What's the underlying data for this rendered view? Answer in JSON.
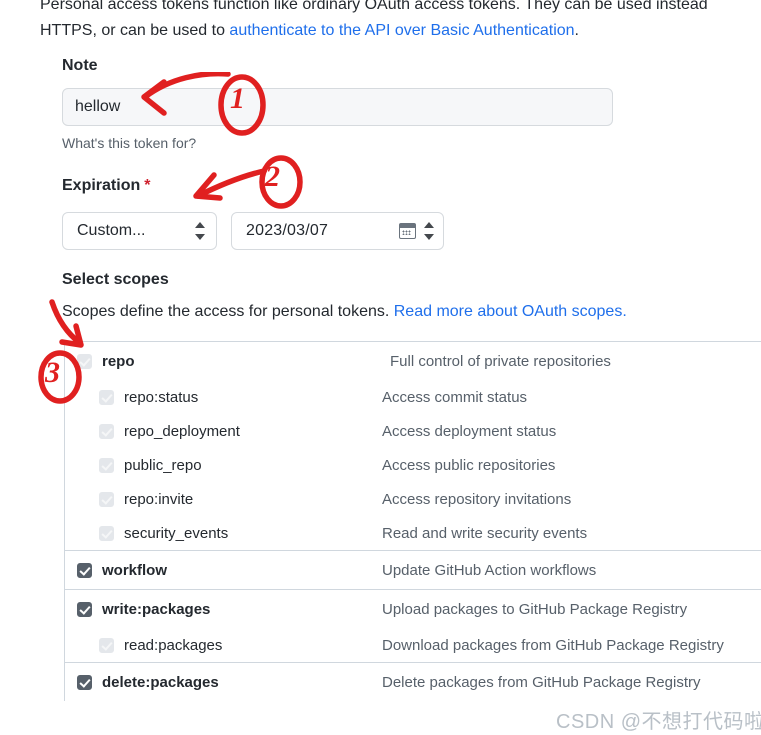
{
  "intro": {
    "line1": "Personal access tokens function like ordinary OAuth access tokens. They can be used instead",
    "line2_pre": "HTTPS, or can be used to ",
    "line2_link": "authenticate to the API over Basic Authentication",
    "line2_post": "."
  },
  "note": {
    "label": "Note",
    "value": "hellow",
    "placeholder": "What's this token for?",
    "helper": "What's this token for?"
  },
  "expiration": {
    "label": "Expiration",
    "required_marker": "*",
    "select_value": "Custom...",
    "date_value": "2023/03/07",
    "calendar_icon": "calendar-icon",
    "spinner_icon": "stepper-arrows-icon"
  },
  "scopes": {
    "heading": "Select scopes",
    "description_pre": "Scopes define the access for personal tokens. ",
    "description_link": "Read more about OAuth scopes.",
    "groups": [
      {
        "items": [
          {
            "name": "repo",
            "desc": "Full control of private repositories",
            "checked": true,
            "disabled": true,
            "sub": false,
            "bold": true
          },
          {
            "name": "repo:status",
            "desc": "Access commit status",
            "checked": true,
            "disabled": true,
            "sub": true,
            "bold": false
          },
          {
            "name": "repo_deployment",
            "desc": "Access deployment status",
            "checked": true,
            "disabled": true,
            "sub": true,
            "bold": false
          },
          {
            "name": "public_repo",
            "desc": "Access public repositories",
            "checked": true,
            "disabled": true,
            "sub": true,
            "bold": false
          },
          {
            "name": "repo:invite",
            "desc": "Access repository invitations",
            "checked": true,
            "disabled": true,
            "sub": true,
            "bold": false
          },
          {
            "name": "security_events",
            "desc": "Read and write security events",
            "checked": true,
            "disabled": true,
            "sub": true,
            "bold": false
          }
        ]
      },
      {
        "items": [
          {
            "name": "workflow",
            "desc": "Update GitHub Action workflows",
            "checked": true,
            "disabled": false,
            "sub": false,
            "bold": true
          }
        ]
      },
      {
        "items": [
          {
            "name": "write:packages",
            "desc": "Upload packages to GitHub Package Registry",
            "checked": true,
            "disabled": false,
            "sub": false,
            "bold": true
          },
          {
            "name": "read:packages",
            "desc": "Download packages from GitHub Package Registry",
            "checked": true,
            "disabled": true,
            "sub": true,
            "bold": false
          }
        ]
      },
      {
        "items": [
          {
            "name": "delete:packages",
            "desc": "Delete packages from GitHub Package Registry",
            "checked": true,
            "disabled": false,
            "sub": false,
            "bold": true
          }
        ]
      }
    ]
  },
  "annotations": [
    {
      "id": "1",
      "label": "1",
      "target": "note-input"
    },
    {
      "id": "2",
      "label": "2",
      "target": "expiration-select"
    },
    {
      "id": "3",
      "label": "3",
      "target": "repo-scope-checkbox"
    }
  ],
  "watermark": {
    "text": "CSDN @不想打代码啦"
  },
  "colors": {
    "link": "#1f6feb",
    "annotation_red": "#e02020",
    "checkbox_checked": "#57606a",
    "checkbox_disabled": "#e4e7eb",
    "border": "#d0d7de",
    "muted_text": "#57606a"
  }
}
